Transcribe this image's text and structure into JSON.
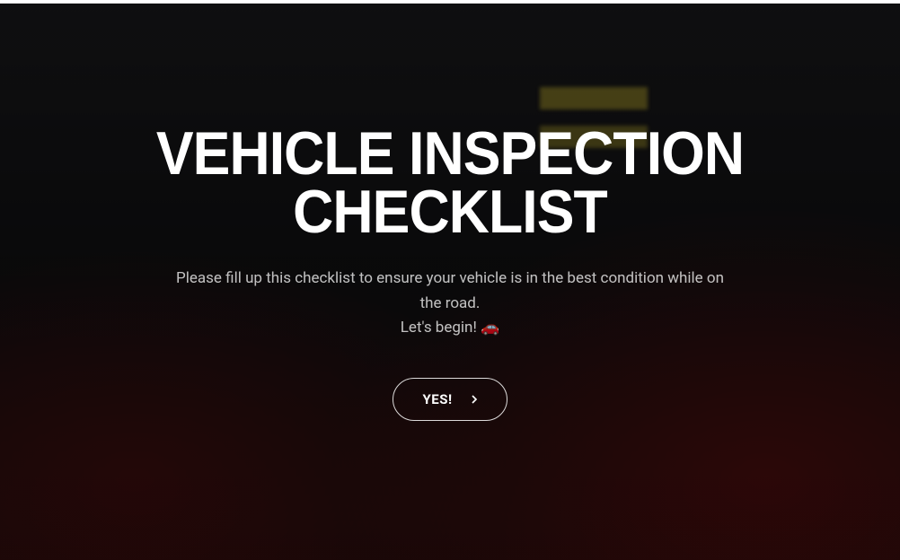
{
  "hero": {
    "title": "VEHICLE INSPECTION CHECKLIST",
    "subtitle_line1": "Please fill up this checklist to ensure your vehicle is in the best condition while on the road.",
    "subtitle_line2": "Let's begin! 🚗"
  },
  "cta": {
    "label": "YES!"
  }
}
